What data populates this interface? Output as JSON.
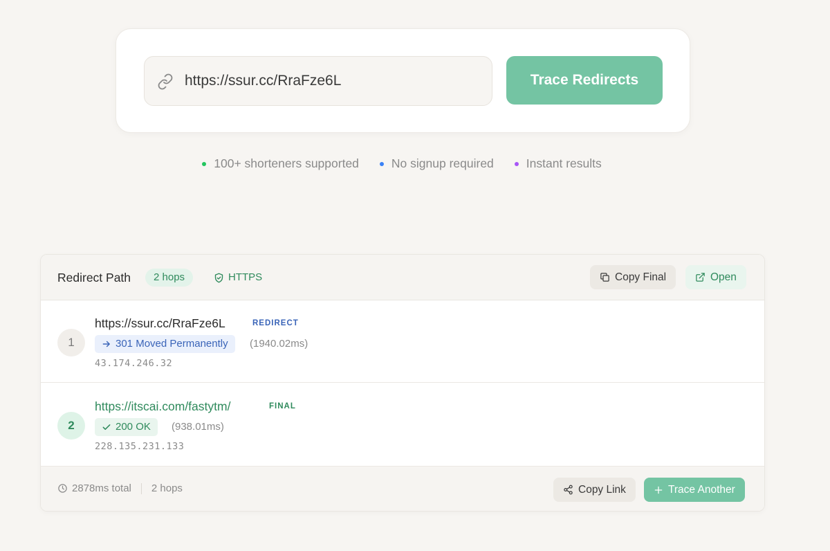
{
  "search": {
    "icon": "link-icon",
    "value": "https://ssur.cc/RraFze6L",
    "button_label": "Trace Redirects"
  },
  "features": [
    {
      "label": "100+ shorteners supported",
      "dot_color": "#22c55e"
    },
    {
      "label": "No signup required",
      "dot_color": "#3b82f6"
    },
    {
      "label": "Instant results",
      "dot_color": "#a855f7"
    }
  ],
  "result": {
    "title": "Redirect Path",
    "hops_badge": "2 hops",
    "https_badge": "HTTPS",
    "copy_final_label": "Copy Final",
    "open_label": "Open",
    "hops": [
      {
        "step": "1",
        "url": "https://ssur.cc/RraFze6L",
        "tag": "REDIRECT",
        "status": "301 Moved Permanently",
        "timing": "(1940.02ms)",
        "ip": "43.174.246.32"
      },
      {
        "step": "2",
        "url": "https://itscai.com/fastytm/",
        "tag": "FINAL",
        "status": "200 OK",
        "timing": "(938.01ms)",
        "ip": "228.135.231.133"
      }
    ],
    "footer": {
      "total_time": "2878ms total",
      "hops": "2 hops",
      "copy_link_label": "Copy Link",
      "trace_another_label": "Trace Another"
    }
  },
  "colors": {
    "accent": "#74c4a3",
    "success": "#2f8a5c",
    "redirect": "#3a64b8"
  }
}
